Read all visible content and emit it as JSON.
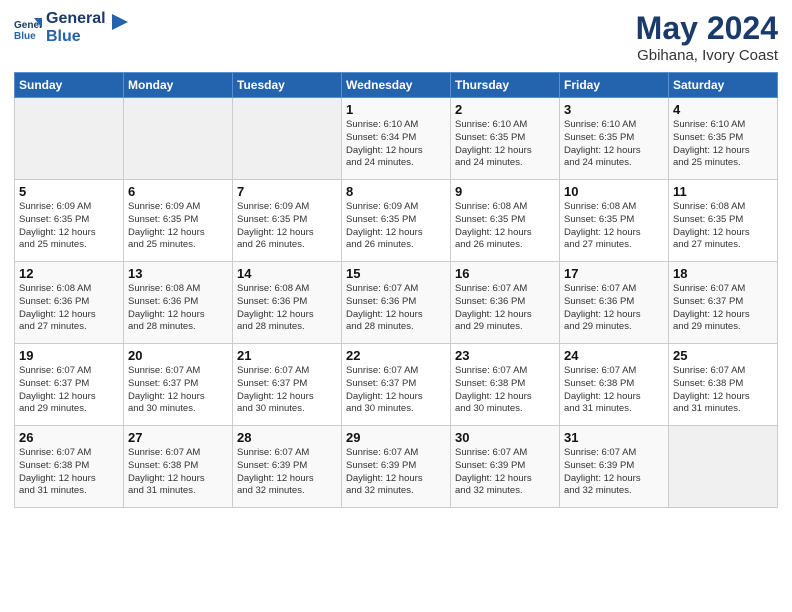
{
  "header": {
    "logo_line1": "General",
    "logo_line2": "Blue",
    "main_title": "May 2024",
    "subtitle": "Gbihana, Ivory Coast"
  },
  "days_of_week": [
    "Sunday",
    "Monday",
    "Tuesday",
    "Wednesday",
    "Thursday",
    "Friday",
    "Saturday"
  ],
  "weeks": [
    [
      {
        "day": "",
        "info": ""
      },
      {
        "day": "",
        "info": ""
      },
      {
        "day": "",
        "info": ""
      },
      {
        "day": "1",
        "info": "Sunrise: 6:10 AM\nSunset: 6:34 PM\nDaylight: 12 hours\nand 24 minutes."
      },
      {
        "day": "2",
        "info": "Sunrise: 6:10 AM\nSunset: 6:35 PM\nDaylight: 12 hours\nand 24 minutes."
      },
      {
        "day": "3",
        "info": "Sunrise: 6:10 AM\nSunset: 6:35 PM\nDaylight: 12 hours\nand 24 minutes."
      },
      {
        "day": "4",
        "info": "Sunrise: 6:10 AM\nSunset: 6:35 PM\nDaylight: 12 hours\nand 25 minutes."
      }
    ],
    [
      {
        "day": "5",
        "info": "Sunrise: 6:09 AM\nSunset: 6:35 PM\nDaylight: 12 hours\nand 25 minutes."
      },
      {
        "day": "6",
        "info": "Sunrise: 6:09 AM\nSunset: 6:35 PM\nDaylight: 12 hours\nand 25 minutes."
      },
      {
        "day": "7",
        "info": "Sunrise: 6:09 AM\nSunset: 6:35 PM\nDaylight: 12 hours\nand 26 minutes."
      },
      {
        "day": "8",
        "info": "Sunrise: 6:09 AM\nSunset: 6:35 PM\nDaylight: 12 hours\nand 26 minutes."
      },
      {
        "day": "9",
        "info": "Sunrise: 6:08 AM\nSunset: 6:35 PM\nDaylight: 12 hours\nand 26 minutes."
      },
      {
        "day": "10",
        "info": "Sunrise: 6:08 AM\nSunset: 6:35 PM\nDaylight: 12 hours\nand 27 minutes."
      },
      {
        "day": "11",
        "info": "Sunrise: 6:08 AM\nSunset: 6:35 PM\nDaylight: 12 hours\nand 27 minutes."
      }
    ],
    [
      {
        "day": "12",
        "info": "Sunrise: 6:08 AM\nSunset: 6:36 PM\nDaylight: 12 hours\nand 27 minutes."
      },
      {
        "day": "13",
        "info": "Sunrise: 6:08 AM\nSunset: 6:36 PM\nDaylight: 12 hours\nand 28 minutes."
      },
      {
        "day": "14",
        "info": "Sunrise: 6:08 AM\nSunset: 6:36 PM\nDaylight: 12 hours\nand 28 minutes."
      },
      {
        "day": "15",
        "info": "Sunrise: 6:07 AM\nSunset: 6:36 PM\nDaylight: 12 hours\nand 28 minutes."
      },
      {
        "day": "16",
        "info": "Sunrise: 6:07 AM\nSunset: 6:36 PM\nDaylight: 12 hours\nand 29 minutes."
      },
      {
        "day": "17",
        "info": "Sunrise: 6:07 AM\nSunset: 6:36 PM\nDaylight: 12 hours\nand 29 minutes."
      },
      {
        "day": "18",
        "info": "Sunrise: 6:07 AM\nSunset: 6:37 PM\nDaylight: 12 hours\nand 29 minutes."
      }
    ],
    [
      {
        "day": "19",
        "info": "Sunrise: 6:07 AM\nSunset: 6:37 PM\nDaylight: 12 hours\nand 29 minutes."
      },
      {
        "day": "20",
        "info": "Sunrise: 6:07 AM\nSunset: 6:37 PM\nDaylight: 12 hours\nand 30 minutes."
      },
      {
        "day": "21",
        "info": "Sunrise: 6:07 AM\nSunset: 6:37 PM\nDaylight: 12 hours\nand 30 minutes."
      },
      {
        "day": "22",
        "info": "Sunrise: 6:07 AM\nSunset: 6:37 PM\nDaylight: 12 hours\nand 30 minutes."
      },
      {
        "day": "23",
        "info": "Sunrise: 6:07 AM\nSunset: 6:38 PM\nDaylight: 12 hours\nand 30 minutes."
      },
      {
        "day": "24",
        "info": "Sunrise: 6:07 AM\nSunset: 6:38 PM\nDaylight: 12 hours\nand 31 minutes."
      },
      {
        "day": "25",
        "info": "Sunrise: 6:07 AM\nSunset: 6:38 PM\nDaylight: 12 hours\nand 31 minutes."
      }
    ],
    [
      {
        "day": "26",
        "info": "Sunrise: 6:07 AM\nSunset: 6:38 PM\nDaylight: 12 hours\nand 31 minutes."
      },
      {
        "day": "27",
        "info": "Sunrise: 6:07 AM\nSunset: 6:38 PM\nDaylight: 12 hours\nand 31 minutes."
      },
      {
        "day": "28",
        "info": "Sunrise: 6:07 AM\nSunset: 6:39 PM\nDaylight: 12 hours\nand 32 minutes."
      },
      {
        "day": "29",
        "info": "Sunrise: 6:07 AM\nSunset: 6:39 PM\nDaylight: 12 hours\nand 32 minutes."
      },
      {
        "day": "30",
        "info": "Sunrise: 6:07 AM\nSunset: 6:39 PM\nDaylight: 12 hours\nand 32 minutes."
      },
      {
        "day": "31",
        "info": "Sunrise: 6:07 AM\nSunset: 6:39 PM\nDaylight: 12 hours\nand 32 minutes."
      },
      {
        "day": "",
        "info": ""
      }
    ]
  ]
}
